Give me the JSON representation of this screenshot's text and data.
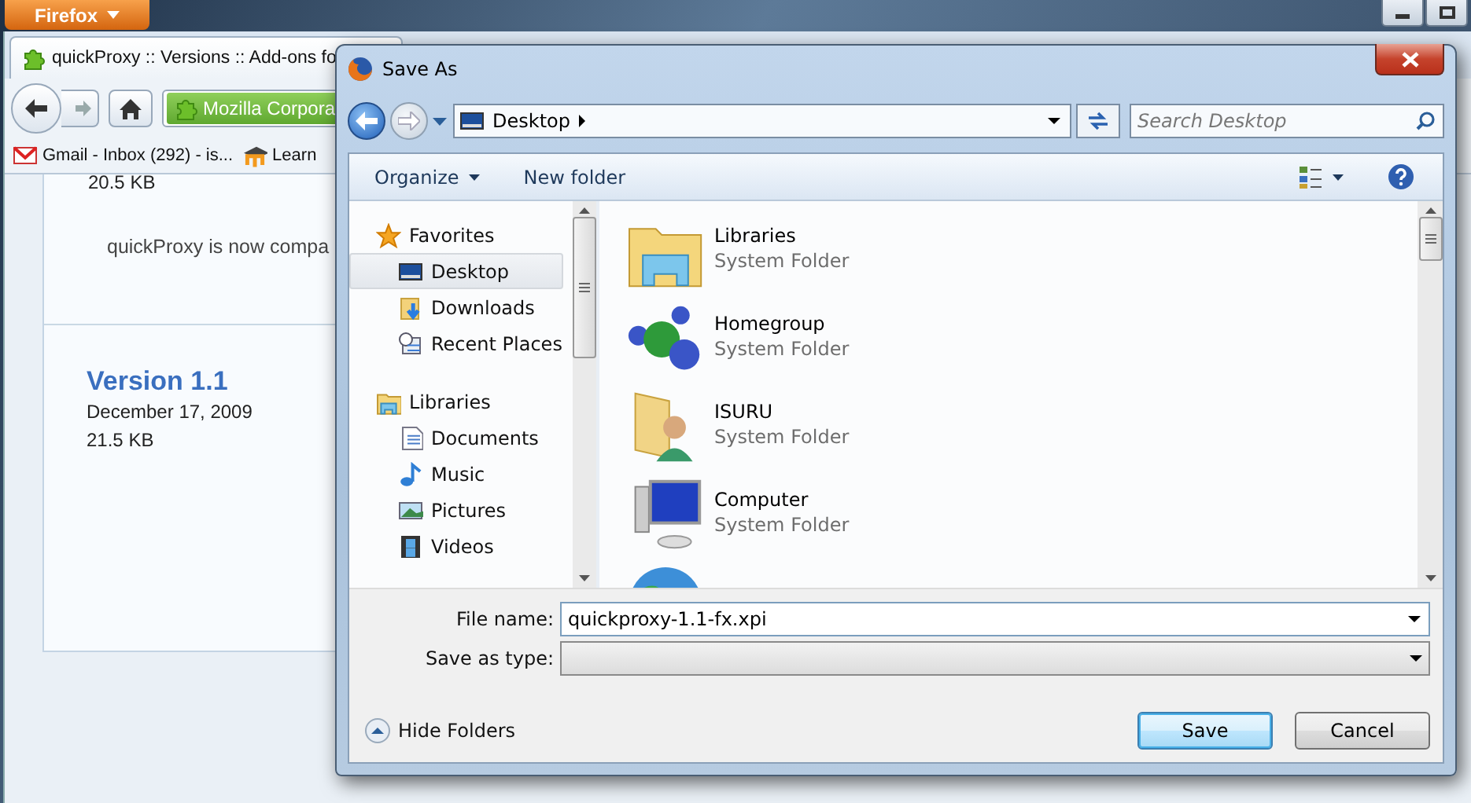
{
  "browser": {
    "menu_button": "Firefox",
    "tab": {
      "title": "quickProxy :: Versions :: Add-ons fo"
    },
    "address": {
      "identity": "Mozilla Corpora"
    },
    "bookmarks": [
      {
        "label": "Gmail - Inbox (292) - is...",
        "kind": "gmail"
      },
      {
        "label": "Learn",
        "kind": "moodle"
      }
    ],
    "page": {
      "previous_size": "20.5 KB",
      "note": "quickProxy is now compa",
      "version": {
        "title": "Version 1.1",
        "date": "December 17, 2009",
        "size": "21.5 KB"
      }
    }
  },
  "dialog": {
    "title": "Save As",
    "breadcrumb": "Desktop",
    "search": {
      "placeholder": "Search Desktop"
    },
    "toolbar": [
      {
        "label": "Organize",
        "dropdown": true
      },
      {
        "label": "New folder",
        "dropdown": false
      }
    ],
    "nav_tree": [
      {
        "label": "Favorites",
        "kind": "star",
        "selected": false,
        "children": [
          {
            "label": "Desktop",
            "kind": "desktop",
            "selected": true
          },
          {
            "label": "Downloads",
            "kind": "downloads",
            "selected": false
          },
          {
            "label": "Recent Places",
            "kind": "recent",
            "selected": false
          }
        ]
      },
      {
        "label": "Libraries",
        "kind": "libraries",
        "selected": false,
        "children": [
          {
            "label": "Documents",
            "kind": "documents",
            "selected": false
          },
          {
            "label": "Music",
            "kind": "music",
            "selected": false
          },
          {
            "label": "Pictures",
            "kind": "pictures",
            "selected": false
          },
          {
            "label": "Videos",
            "kind": "videos",
            "selected": false
          }
        ]
      }
    ],
    "files": [
      {
        "name": "Libraries",
        "type": "System Folder",
        "kind": "libraries"
      },
      {
        "name": "Homegroup",
        "type": "System Folder",
        "kind": "homegroup"
      },
      {
        "name": "ISURU",
        "type": "System Folder",
        "kind": "user"
      },
      {
        "name": "Computer",
        "type": "System Folder",
        "kind": "computer"
      },
      {
        "kind": "network"
      }
    ],
    "file_name": {
      "label": "File name:",
      "value": "quickproxy-1.1-fx.xpi"
    },
    "save_as_type": {
      "label": "Save as type:"
    },
    "hide_folders": "Hide Folders",
    "buttons": [
      {
        "label": "Save",
        "default": true
      },
      {
        "label": "Cancel",
        "default": false
      }
    ]
  }
}
